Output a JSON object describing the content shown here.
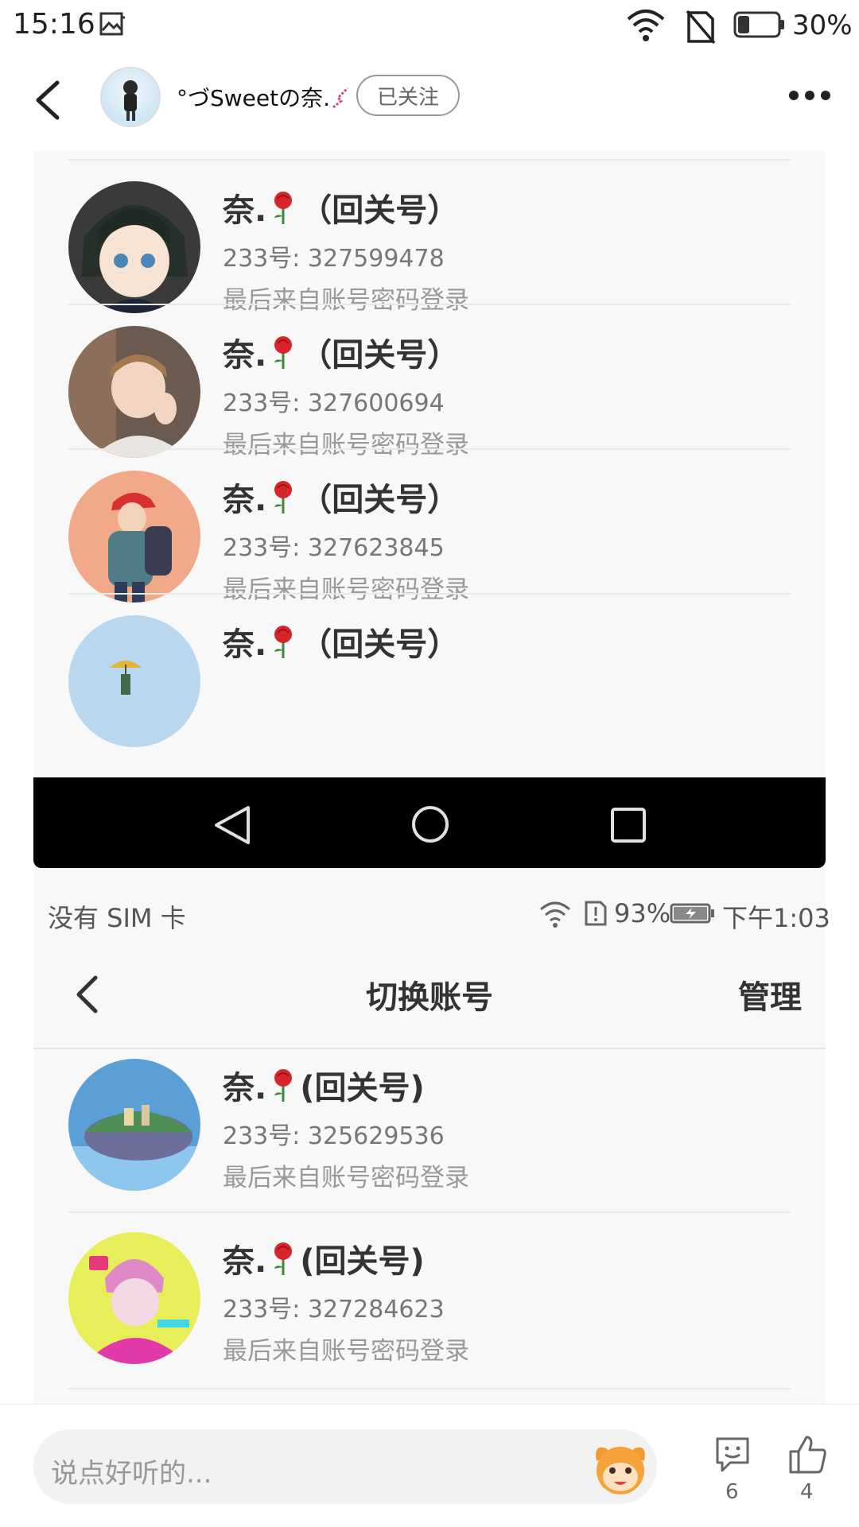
{
  "status_bar": {
    "time": "15:16",
    "battery": "30%"
  },
  "header": {
    "username": "°づSweetの奈.",
    "follow_label": "已关注"
  },
  "top_accounts": [
    {
      "name": "奈.",
      "suffix": "（回关号）",
      "uid": "233号: 327599478",
      "login": "最后来自账号密码登录"
    },
    {
      "name": "奈.",
      "suffix": "（回关号）",
      "uid": "233号: 327600694",
      "login": "最后来自账号密码登录"
    },
    {
      "name": "奈.",
      "suffix": "（回关号）",
      "uid": "233号: 327623845",
      "login": "最后来自账号密码登录"
    },
    {
      "name": "奈.",
      "suffix": "（回关号）"
    }
  ],
  "inner_status": {
    "sim": "没有 SIM 卡",
    "battery": "93%",
    "time": "下午1:03"
  },
  "inner_header": {
    "title": "切换账号",
    "manage": "管理"
  },
  "bottom_accounts": [
    {
      "name": "奈.",
      "suffix": "(回关号)",
      "uid": "233号: 325629536",
      "login": "最后来自账号密码登录"
    },
    {
      "name": "奈.",
      "suffix": "(回关号)",
      "uid": "233号: 327284623",
      "login": "最后来自账号密码登录"
    }
  ],
  "bottom_bar": {
    "placeholder": "说点好听的...",
    "emoji_count": "6",
    "like_count": "4"
  },
  "colors": {
    "accent_rose": "#d8252b",
    "panel_bg": "#f8f8f8"
  }
}
